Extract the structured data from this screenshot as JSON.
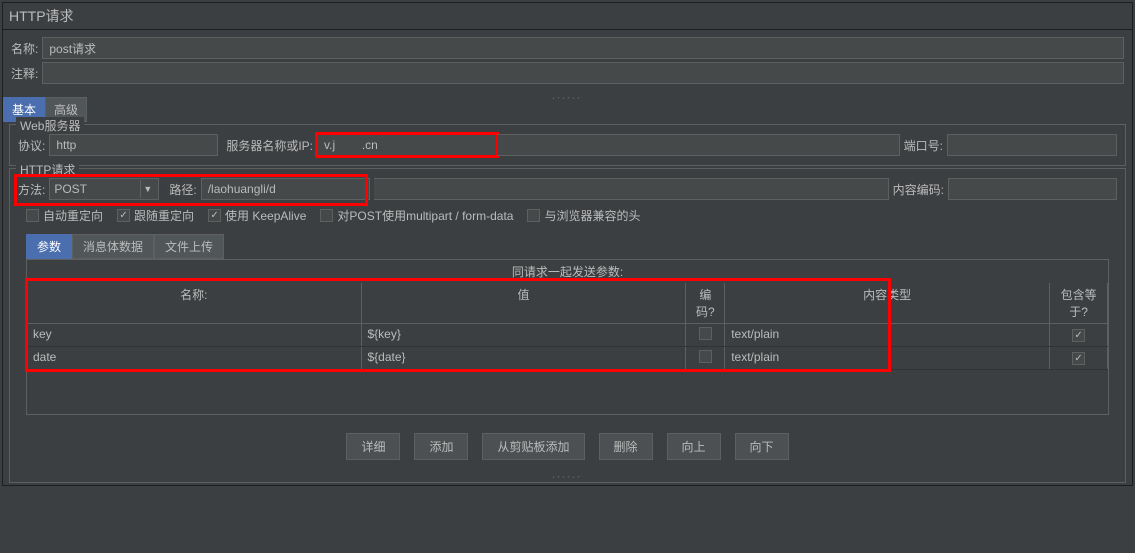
{
  "title": "HTTP请求",
  "name_label": "名称:",
  "name_value": "post请求",
  "comment_label": "注释:",
  "comment_value": "",
  "tabs": {
    "basic": "基本",
    "advanced": "高级"
  },
  "web_server": {
    "legend": "Web服务器",
    "protocol_label": "协议:",
    "protocol_value": "http",
    "host_label": "服务器名称或IP:",
    "host_value": "v.j        .cn",
    "port_label": "端口号:",
    "port_value": ""
  },
  "http_req": {
    "legend": "HTTP请求",
    "method_label": "方法:",
    "method_value": "POST",
    "path_label": "路径:",
    "path_value": "/laohuangli/d",
    "enc_label": "内容编码:",
    "enc_value": ""
  },
  "opts": {
    "redir_auto": "自动重定向",
    "follow_redir": "跟随重定向",
    "keepalive": "使用 KeepAlive",
    "multipart": "对POST使用multipart / form-data",
    "browser_hdrs": "与浏览器兼容的头"
  },
  "subtabs": {
    "params": "参数",
    "body": "消息体数据",
    "upload": "文件上传"
  },
  "params_caption": "同请求一起发送参数:",
  "cols": {
    "name": "名称:",
    "value": "值",
    "encode": "编码?",
    "ctype": "内容类型",
    "include": "包含等于?"
  },
  "rows": [
    {
      "name": "key",
      "value": "${key}",
      "encode": false,
      "ctype": "text/plain",
      "include": true
    },
    {
      "name": "date",
      "value": "${date}",
      "encode": false,
      "ctype": "text/plain",
      "include": true
    }
  ],
  "buttons": {
    "detail": "详细",
    "add": "添加",
    "clip": "从剪贴板添加",
    "del": "删除",
    "up": "向上",
    "down": "向下"
  }
}
